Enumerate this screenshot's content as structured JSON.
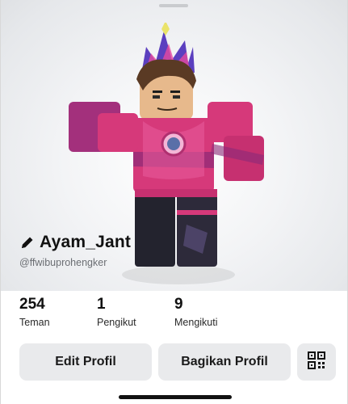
{
  "profile": {
    "display_name": "Ayam_Jant",
    "username": "@ffwibuprohengker"
  },
  "stats": [
    {
      "value": "254",
      "label": "Teman"
    },
    {
      "value": "1",
      "label": "Pengikut"
    },
    {
      "value": "9",
      "label": "Mengikuti"
    }
  ],
  "actions": {
    "edit_label": "Edit Profil",
    "share_label": "Bagikan Profil"
  },
  "icons": {
    "edit": "pencil-icon",
    "qr": "qr-code-icon"
  },
  "colors": {
    "avatar_primary": "#d6397a",
    "button_bg": "#e9eaec"
  }
}
